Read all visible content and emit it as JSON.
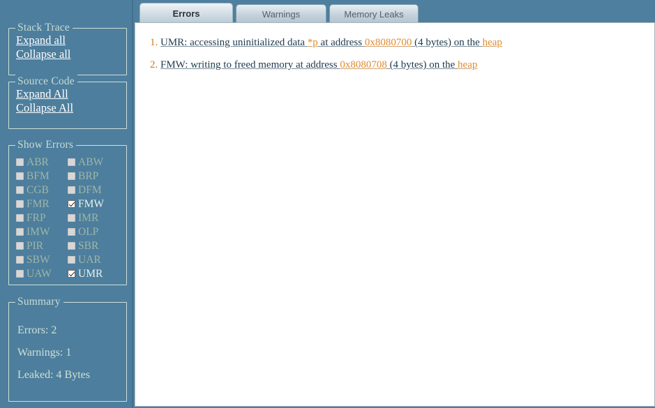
{
  "theme": {
    "sidebar_bg": "#4d7e9d",
    "panel_bg": "#ffffff",
    "accent_orange": "#e08b2e",
    "link_white": "#ffffff",
    "group_border": "#cfe0d8",
    "disabled_label": "#9fb6a8"
  },
  "sidebar": {
    "groups": [
      {
        "title": "Stack Trace",
        "links": [
          {
            "label": "Expand all"
          },
          {
            "label": "Collapse all"
          }
        ]
      },
      {
        "title": "Source Code",
        "links": [
          {
            "label": "Expand All"
          },
          {
            "label": "Collapse All"
          }
        ]
      }
    ],
    "show_errors": {
      "title": "Show Errors",
      "checkboxes": [
        {
          "label": "ABR",
          "checked": false,
          "enabled": false
        },
        {
          "label": "ABW",
          "checked": false,
          "enabled": false
        },
        {
          "label": "BFM",
          "checked": false,
          "enabled": false
        },
        {
          "label": "BRP",
          "checked": false,
          "enabled": false
        },
        {
          "label": "CGB",
          "checked": false,
          "enabled": false
        },
        {
          "label": "DFM",
          "checked": false,
          "enabled": false
        },
        {
          "label": "FMR",
          "checked": false,
          "enabled": false
        },
        {
          "label": "FMW",
          "checked": true,
          "enabled": true
        },
        {
          "label": "FRP",
          "checked": false,
          "enabled": false
        },
        {
          "label": "IMR",
          "checked": false,
          "enabled": false
        },
        {
          "label": "IMW",
          "checked": false,
          "enabled": false
        },
        {
          "label": "OLP",
          "checked": false,
          "enabled": false
        },
        {
          "label": "PIR",
          "checked": false,
          "enabled": false
        },
        {
          "label": "SBR",
          "checked": false,
          "enabled": false
        },
        {
          "label": "SBW",
          "checked": false,
          "enabled": false
        },
        {
          "label": "UAR",
          "checked": false,
          "enabled": false
        },
        {
          "label": "UAW",
          "checked": false,
          "enabled": false
        },
        {
          "label": "UMR",
          "checked": true,
          "enabled": true
        }
      ]
    },
    "summary": {
      "title": "Summary",
      "lines": [
        "Errors: 2",
        "Warnings: 1",
        "Leaked: 4 Bytes"
      ]
    }
  },
  "content": {
    "tabs": [
      {
        "label": "Errors",
        "active": true
      },
      {
        "label": "Warnings",
        "active": false
      },
      {
        "label": "Memory Leaks",
        "active": false
      }
    ],
    "errors": [
      {
        "number": "1.",
        "segments": [
          {
            "text": "UMR: accessing uninitialized data ",
            "highlight": false
          },
          {
            "text": "*p",
            "highlight": true
          },
          {
            "text": " at address ",
            "highlight": false
          },
          {
            "text": "0x8080700",
            "highlight": true
          },
          {
            "text": " (4 bytes) on the ",
            "highlight": false
          },
          {
            "text": "heap",
            "highlight": true
          }
        ]
      },
      {
        "number": "2.",
        "segments": [
          {
            "text": "FMW: writing to freed memory at address ",
            "highlight": false
          },
          {
            "text": "0x8080708",
            "highlight": true
          },
          {
            "text": " (4 bytes) on the ",
            "highlight": false
          },
          {
            "text": "heap",
            "highlight": true
          }
        ]
      }
    ]
  }
}
